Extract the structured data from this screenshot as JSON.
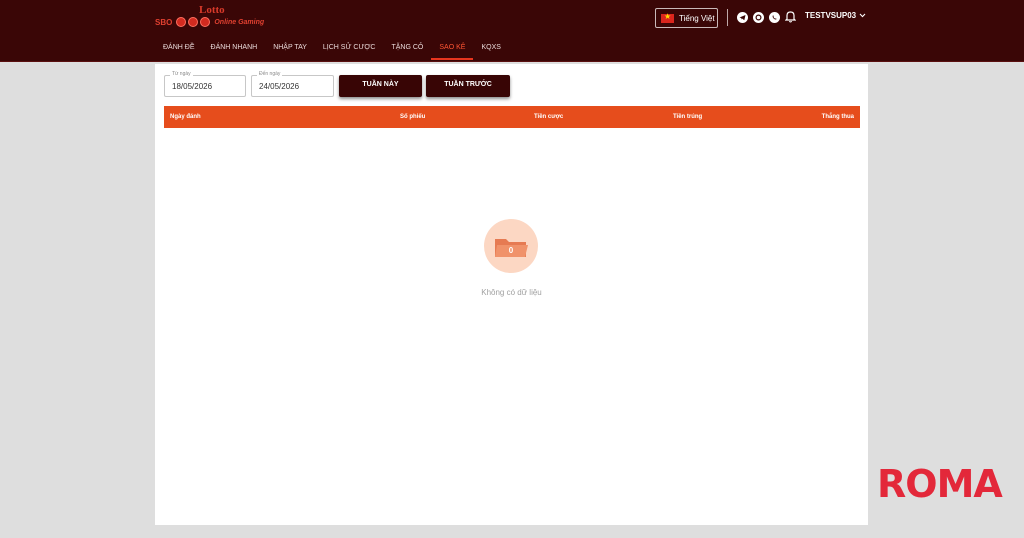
{
  "brand": {
    "logo_top": "Lotto",
    "logo_left": "SBO",
    "logo_right": "Online Gaming"
  },
  "header": {
    "language": "Tiếng Việt",
    "username": "TESTVSUP03"
  },
  "nav": [
    {
      "label": "ĐÁNH ĐỀ"
    },
    {
      "label": "ĐÁNH NHANH"
    },
    {
      "label": "NHẬP TAY"
    },
    {
      "label": "LỊCH SỬ CƯỢC"
    },
    {
      "label": "TẶNG CỎ"
    },
    {
      "label": "SAO KÊ",
      "active": true
    },
    {
      "label": "KQXS"
    }
  ],
  "filter": {
    "from_label": "Từ ngày",
    "from_value": "18/05/2026",
    "to_label": "Đến ngày",
    "to_value": "24/05/2026",
    "this_week": "TUẦN NÀY",
    "last_week": "TUẦN TRƯỚC"
  },
  "table": {
    "columns": [
      "Ngày đánh",
      "Số phiếu",
      "Tiền cược",
      "Tiền trúng",
      "Thắng thua"
    ]
  },
  "empty": {
    "badge": "0",
    "text": "Không có dữ liệu"
  },
  "watermark": "ROMA",
  "colors": {
    "header_bg": "#3a0606",
    "accent": "#e64d1c",
    "button_bg": "#380505",
    "active_nav": "#ff5533"
  }
}
